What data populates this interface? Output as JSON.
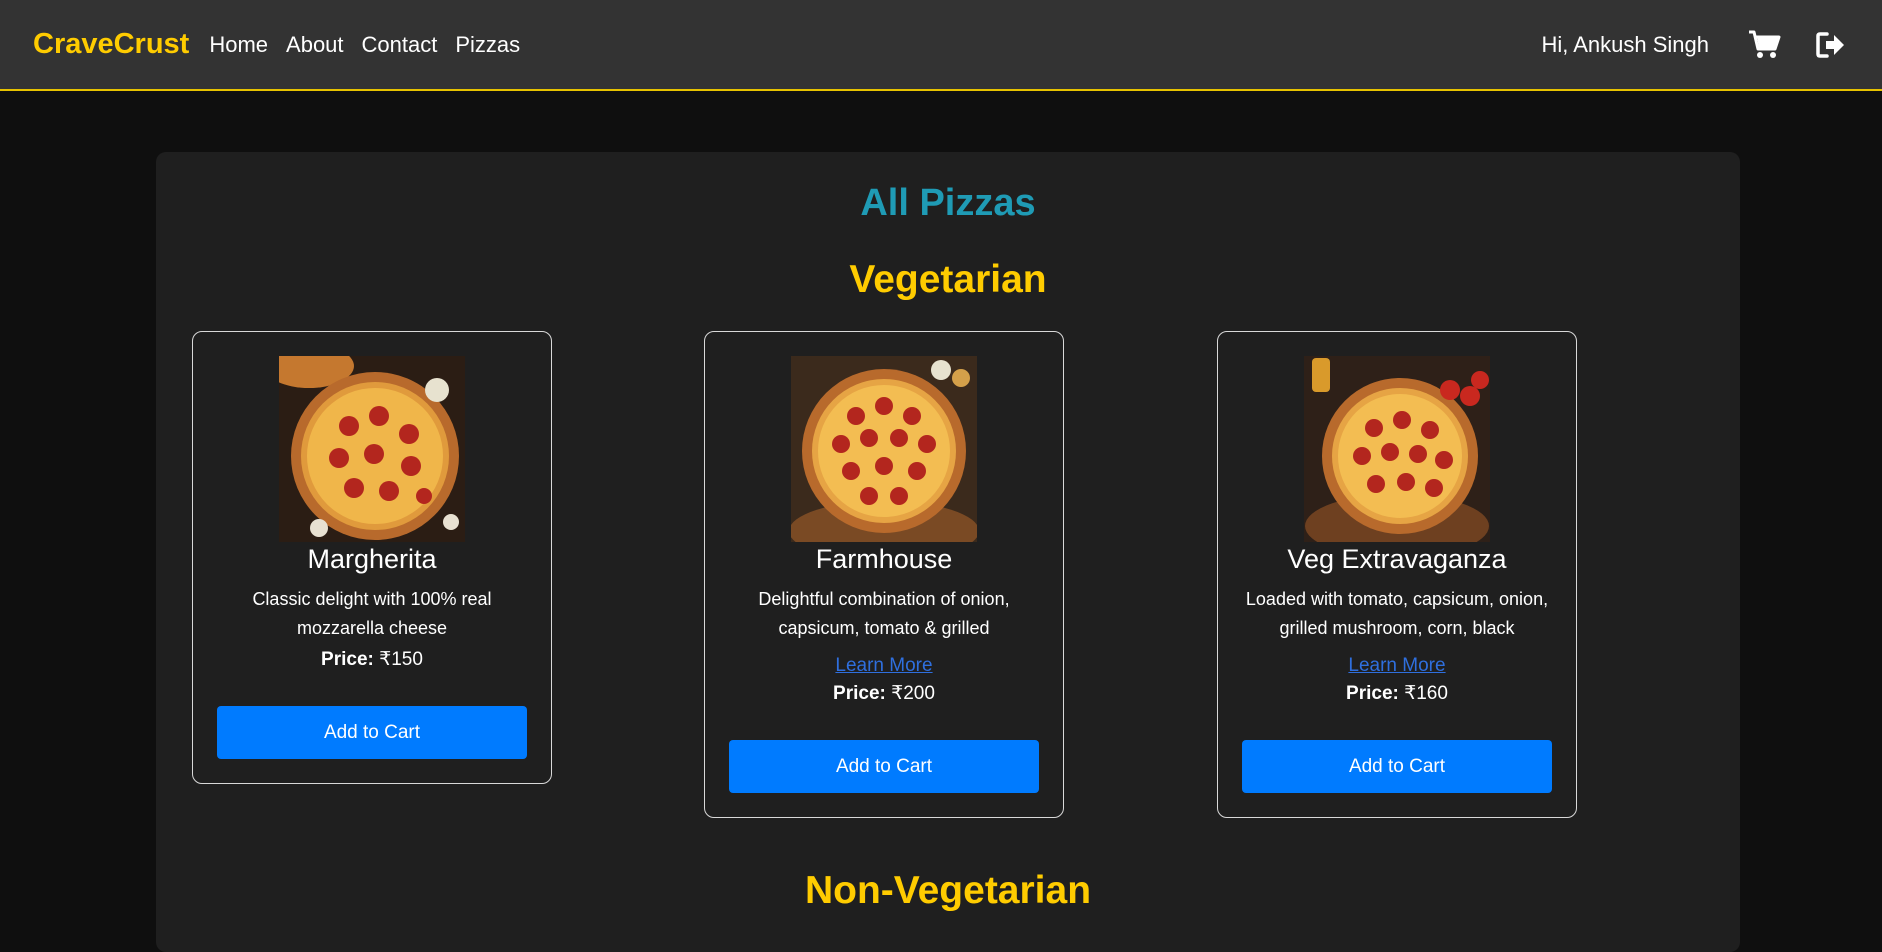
{
  "navbar": {
    "brand": "CraveCrust",
    "links": [
      "Home",
      "About",
      "Contact",
      "Pizzas"
    ],
    "greeting": "Hi, Ankush Singh",
    "icons": [
      "cart-icon",
      "logout-icon"
    ],
    "accent_color": "#ffcc00"
  },
  "main": {
    "title": "All Pizzas",
    "sections": [
      {
        "title": "Vegetarian",
        "items": [
          {
            "name": "Margherita",
            "description": "Classic delight with 100% real mozzarella cheese",
            "learn_more": "",
            "price_label": "Price:",
            "price": "₹150",
            "button": "Add to Cart"
          },
          {
            "name": "Farmhouse",
            "description": "Delightful combination of onion, capsicum, tomato & grilled",
            "learn_more": "Learn More",
            "price_label": "Price:",
            "price": "₹200",
            "button": "Add to Cart"
          },
          {
            "name": "Veg Extravaganza",
            "description": "Loaded with tomato, capsicum, onion, grilled mushroom, corn, black",
            "learn_more": "Learn More",
            "price_label": "Price:",
            "price": "₹160",
            "button": "Add to Cart"
          }
        ]
      },
      {
        "title": "Non-Vegetarian",
        "items": []
      }
    ]
  },
  "colors": {
    "title": "#1f9bb5",
    "section": "#ffcc00",
    "button": "#007bff",
    "link": "#2f6fde"
  }
}
